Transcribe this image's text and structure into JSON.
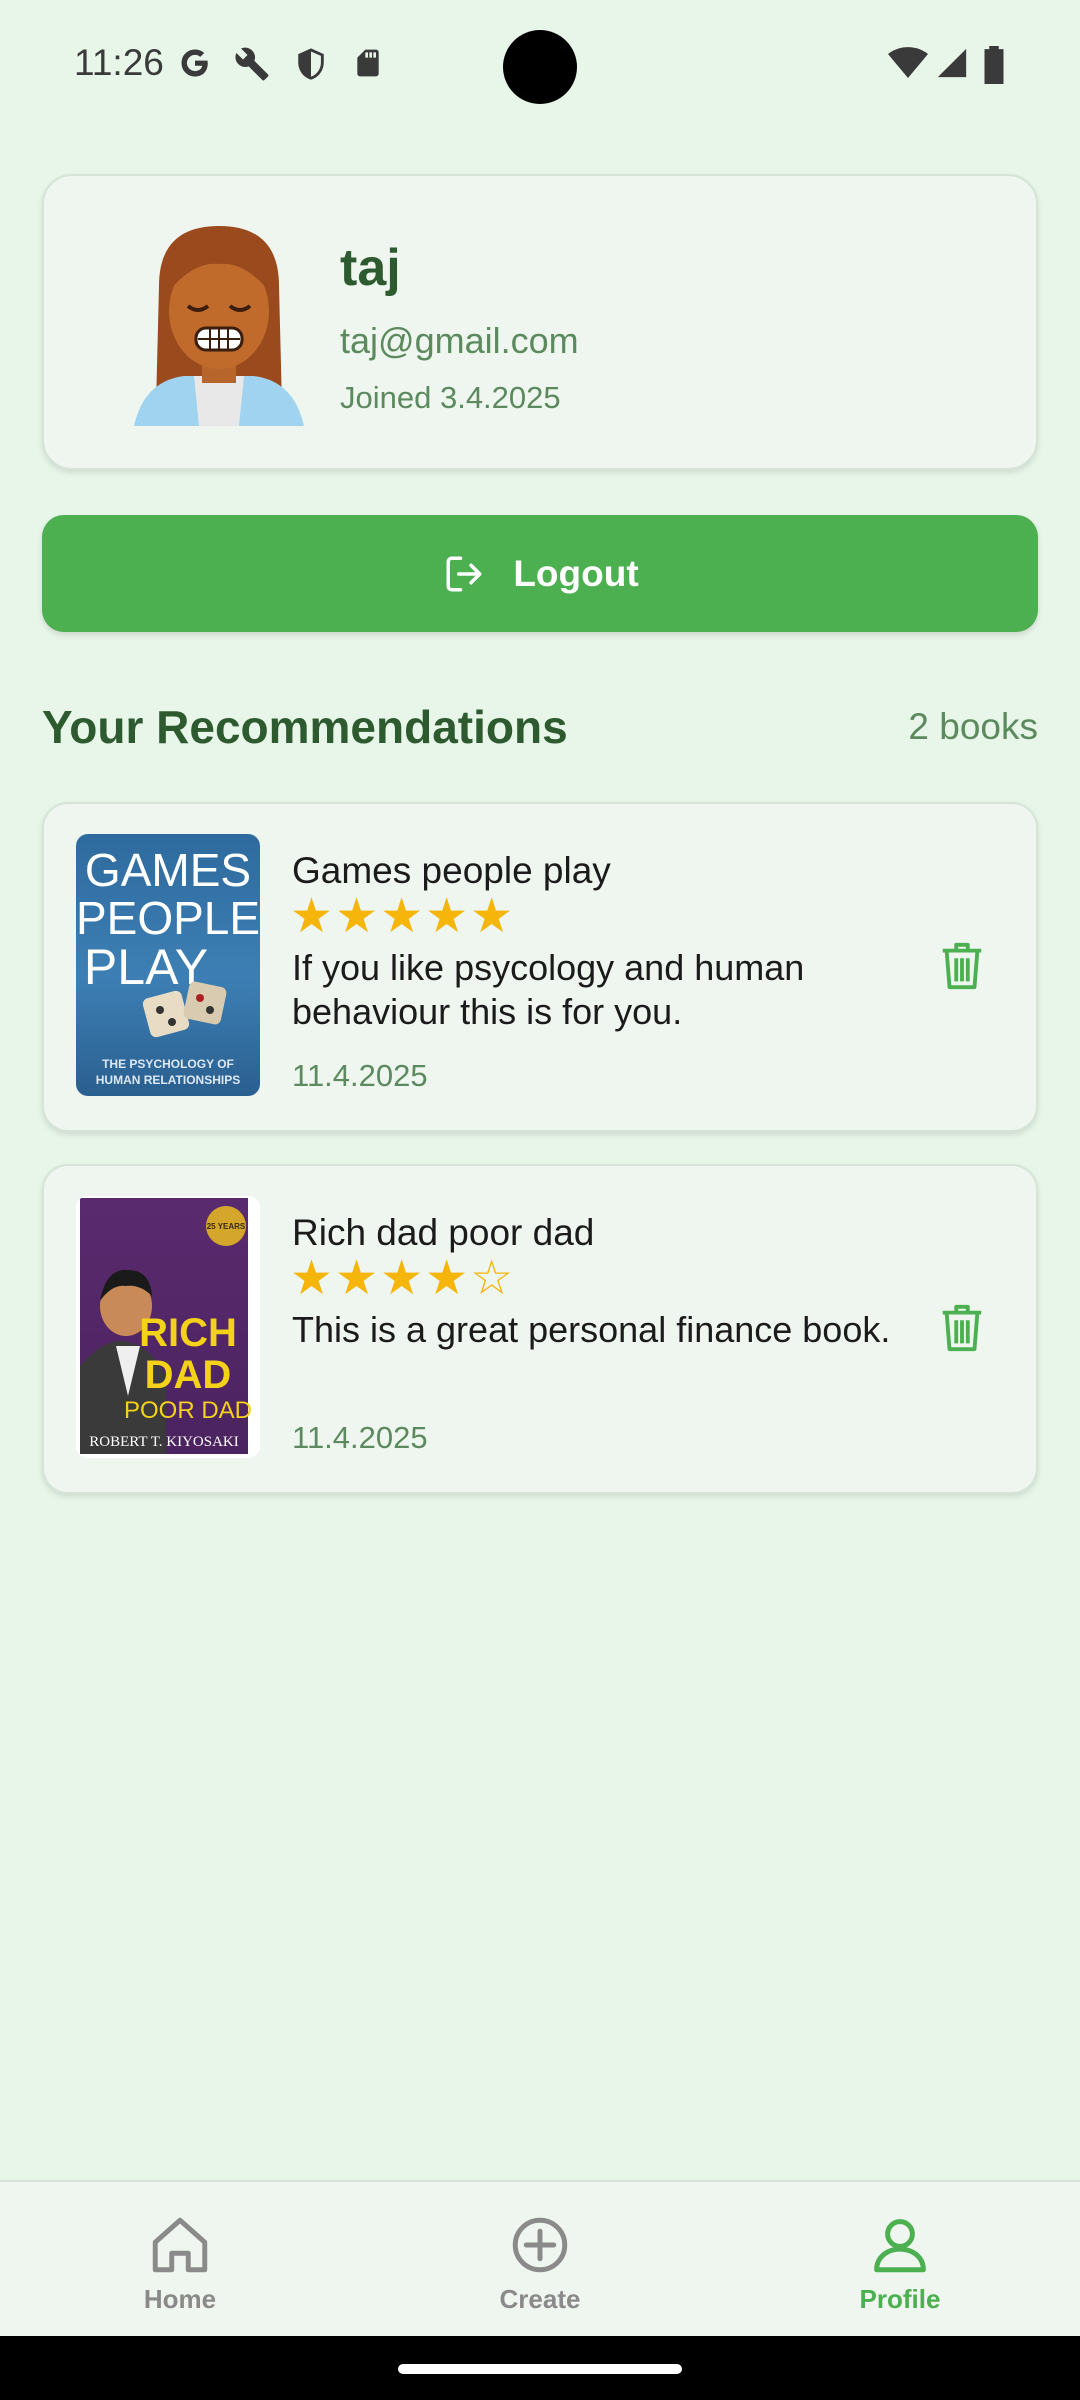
{
  "status_bar": {
    "time": "11:26",
    "icons": [
      "google-icon",
      "wrench-icon",
      "shield-icon",
      "sd-card-icon",
      "wifi-icon",
      "signal-icon",
      "battery-icon"
    ]
  },
  "profile": {
    "name": "taj",
    "email": "taj@gmail.com",
    "joined": "Joined 3.4.2025"
  },
  "logout": {
    "label": "Logout",
    "icon": "logout-icon"
  },
  "recommendations": {
    "title": "Your Recommendations",
    "count": "2 books",
    "items": [
      {
        "title": "Games people play",
        "rating": 5,
        "stars": "★★★★★",
        "text": "If you like psycology and human behaviour this is for you.",
        "date": "11.4.2025",
        "cover": {
          "lines": [
            "GAMES",
            "PEOPLE",
            "PLAY"
          ],
          "subtitle": "THE PSYCHOLOGY OF HUMAN RELATIONSHIPS"
        }
      },
      {
        "title": "Rich dad poor dad",
        "rating": 4,
        "stars": "★★★★☆",
        "text": "This is a great personal finance book.",
        "date": "11.4.2025",
        "cover": {
          "lines": [
            "RICH",
            "DAD",
            "POOR DAD"
          ],
          "author": "ROBERT T. KIYOSAKI",
          "badge": "25 YEARS"
        }
      }
    ]
  },
  "nav": {
    "items": [
      {
        "label": "Home",
        "icon": "home-icon",
        "active": false
      },
      {
        "label": "Create",
        "icon": "plus-circle-icon",
        "active": false
      },
      {
        "label": "Profile",
        "icon": "person-icon",
        "active": true
      }
    ]
  },
  "colors": {
    "background": "#e8f5e9",
    "card": "#eef6ef",
    "accent": "#4caf50",
    "heading": "#2e5a2f",
    "muted": "#5c8a5e",
    "star": "#f5b50a"
  }
}
